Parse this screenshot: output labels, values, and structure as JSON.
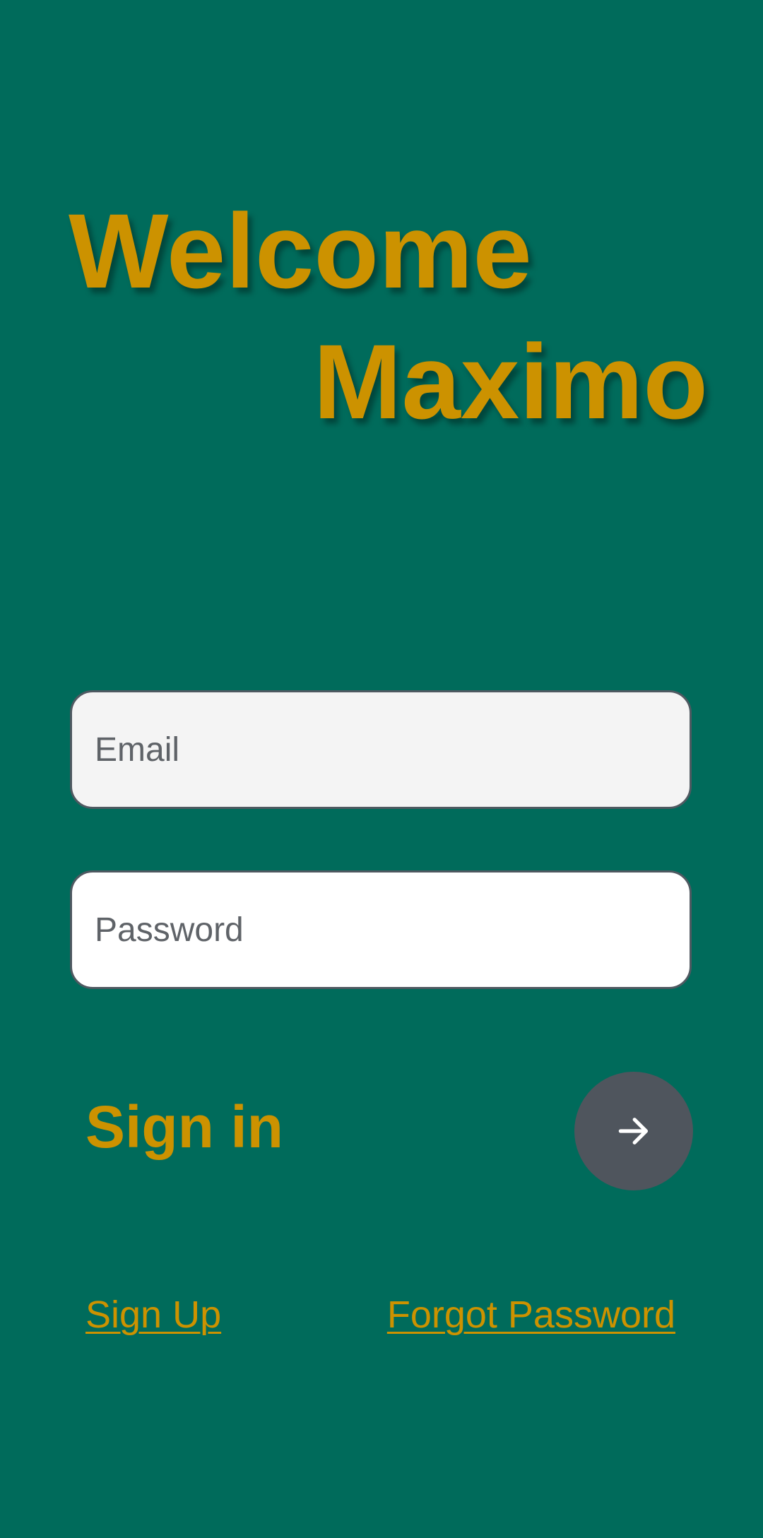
{
  "header": {
    "welcome": "Welcome",
    "name": "Maximo"
  },
  "form": {
    "email_placeholder": "Email",
    "password_placeholder": "Password",
    "signin_label": "Sign in",
    "submit_icon": "arrow-right-icon"
  },
  "links": {
    "signup": "Sign Up",
    "forgot": "Forgot Password"
  },
  "colors": {
    "background": "#006b5b",
    "accent": "#cc9200",
    "button": "#4f555d"
  }
}
